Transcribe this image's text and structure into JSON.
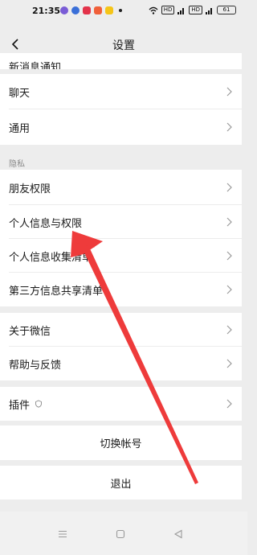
{
  "status_bar": {
    "time": "21:35",
    "hd_badge": "HD",
    "hd_badge2": "HD",
    "battery": "61"
  },
  "nav": {
    "title": "设置"
  },
  "rows": {
    "partial_top": "新消息通知",
    "chat": "聊天",
    "general": "通用",
    "privacy_section": "隐私",
    "friend_permissions": "朋友权限",
    "personal_info_permissions": "个人信息与权限",
    "personal_info_collection": "个人信息收集清单",
    "third_party_sharing": "第三方信息共享清单",
    "about_wechat": "关于微信",
    "help_feedback": "帮助与反馈",
    "plugins": "插件",
    "switch_account": "切换帐号",
    "logout": "退出"
  },
  "colors": {
    "background": "#ededed",
    "row_background": "#ffffff",
    "annotation_arrow": "#ee3b3b"
  }
}
